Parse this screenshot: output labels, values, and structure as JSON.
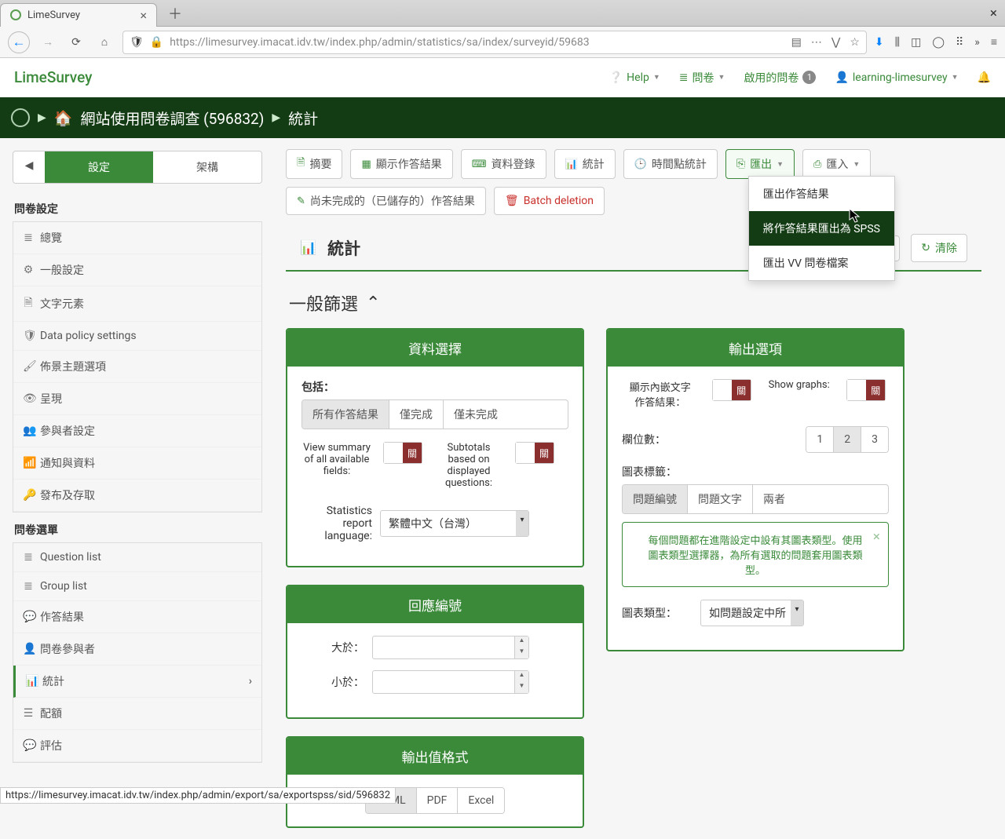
{
  "browser": {
    "tab_title": "LimeSurvey",
    "url": "https://limesurvey.imacat.idv.tw/index.php/admin/statistics/sa/index/surveyid/59683"
  },
  "header": {
    "logo": "LimeSurvey",
    "help": "Help",
    "surveys": "問卷",
    "active_surveys": "啟用的問卷",
    "active_count": "1",
    "user": "learning-limesurvey"
  },
  "breadcrumb": {
    "survey": "網站使用問卷調查 (596832)",
    "page": "統計"
  },
  "sidebar": {
    "tabs": {
      "settings": "設定",
      "structure": "架構"
    },
    "h1": "問卷設定",
    "h2": "問卷選單",
    "settings_items": [
      "總覽",
      "一般設定",
      "文字元素",
      "Data policy settings",
      "佈景主題選項",
      "呈現",
      "參與者設定",
      "通知與資料",
      "發布及存取"
    ],
    "menu_items": [
      "Question list",
      "Group list",
      "作答結果",
      "問卷參與者",
      "統計",
      "配額",
      "評估"
    ]
  },
  "toolbar": {
    "summary": "摘要",
    "display": "顯示作答結果",
    "dataentry": "資料登錄",
    "stats": "統計",
    "timing": "時間點統計",
    "export": "匯出",
    "import": "匯入",
    "saved": "尚未完成的（已儲存的）作答結果",
    "batch": "Batch deletion"
  },
  "export_menu": {
    "responses": "匯出作答結果",
    "spss": "將作答結果匯出為 SPSS",
    "vv": "匯出 VV 問卷檔案"
  },
  "page": {
    "title": "統計",
    "clear": "清除",
    "filter_title": "一般篩選"
  },
  "card1": {
    "title": "資料選擇",
    "include": "包括：",
    "opt_all": "所有作答結果",
    "opt_complete": "僅完成",
    "opt_incomplete": "僅未完成",
    "view_summary": "View summary of all available fields:",
    "subtotals": "Subtotals based on displayed questions:",
    "lang": "Statistics report language:",
    "lang_val": "繁體中文（台灣）",
    "off": "關"
  },
  "card2": {
    "title": "回應編號",
    "gt": "大於：",
    "lt": "小於："
  },
  "card3": {
    "title": "輸出值格式",
    "html": "HTML",
    "pdf": "PDF",
    "excel": "Excel"
  },
  "card4": {
    "title": "輸出選項",
    "inline": "顯示內嵌文字作答結果：",
    "graphs": "Show graphs:",
    "cols": "欄位數：",
    "c1": "1",
    "c2": "2",
    "c3": "3",
    "labels": "圖表標籤：",
    "l_code": "問題編號",
    "l_text": "問題文字",
    "l_both": "兩者",
    "alert": "每個問題都在進階設定中設有其圖表類型。使用圖表類型選擇器，為所有選取的問題套用圖表類型。",
    "chart_type": "圖表類型：",
    "chart_type_val": "如問題設定中所",
    "off": "關"
  },
  "status_url": "https://limesurvey.imacat.idv.tw/index.php/admin/export/sa/exportspss/sid/596832"
}
